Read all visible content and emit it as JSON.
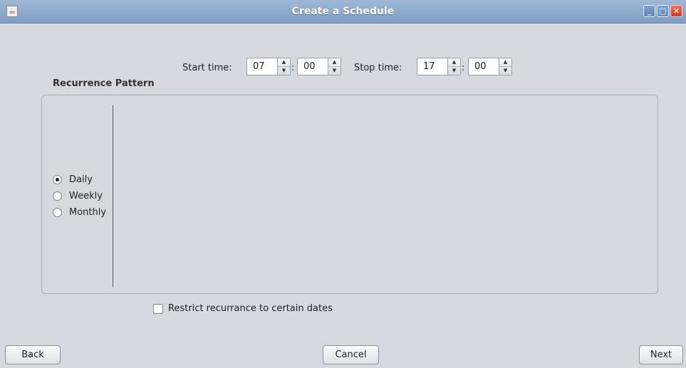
{
  "window": {
    "title": "Create a Schedule",
    "minimize_glyph": "_",
    "maximize_glyph": "□",
    "close_glyph": "✕"
  },
  "time": {
    "start_label": "Start time:",
    "start_hour": "07",
    "start_minute": "00",
    "stop_label": "Stop time:",
    "stop_hour": "17",
    "stop_minute": "00",
    "separator": ":"
  },
  "recurrence": {
    "label": "Recurrence Pattern",
    "options": [
      {
        "label": "Daily",
        "selected": true
      },
      {
        "label": "Weekly",
        "selected": false
      },
      {
        "label": "Monthly",
        "selected": false
      }
    ]
  },
  "restrict": {
    "label": "Restrict recurrance to certain dates",
    "checked": false
  },
  "buttons": {
    "back": "Back",
    "cancel": "Cancel",
    "next": "Next"
  },
  "icons": {
    "app": "java-cup-icon",
    "spinner_up": "▲",
    "spinner_down": "▼"
  }
}
